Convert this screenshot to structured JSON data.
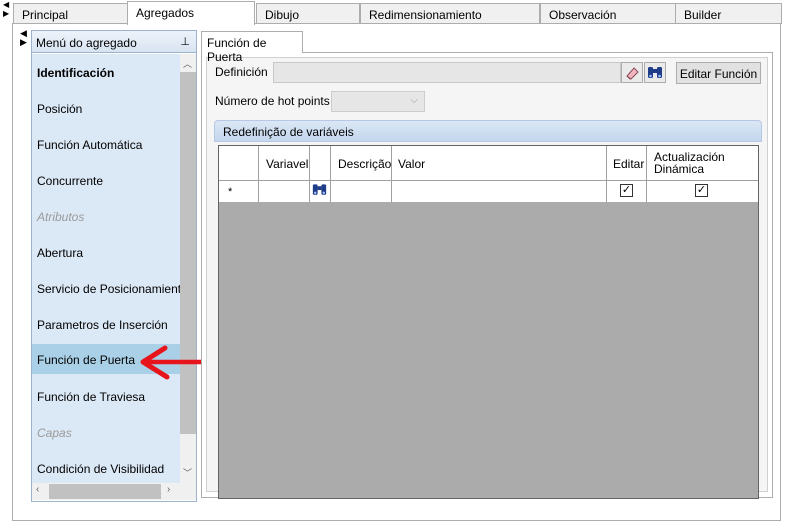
{
  "tabs": [
    {
      "label": "Principal",
      "active": false
    },
    {
      "label": "Agregados",
      "active": true
    },
    {
      "label": "Dibujo",
      "active": false
    },
    {
      "label": "Redimensionamiento",
      "active": false
    },
    {
      "label": "Observación",
      "active": false
    },
    {
      "label": "Builder",
      "active": false
    }
  ],
  "side_menu": {
    "title": "Menú do agregado",
    "items": [
      {
        "label": "Identificación",
        "style": "bold"
      },
      {
        "label": "Posición",
        "style": "normal"
      },
      {
        "label": "Función Automática",
        "style": "normal"
      },
      {
        "label": "Concurrente",
        "style": "normal"
      },
      {
        "label": "Atributos",
        "style": "category"
      },
      {
        "label": "Abertura",
        "style": "normal"
      },
      {
        "label": "Servicio de Posicionamiento",
        "style": "normal"
      },
      {
        "label": "Parametros de Inserción",
        "style": "normal"
      },
      {
        "label": "Función de Puerta",
        "style": "selected"
      },
      {
        "label": "Función de Traviesa",
        "style": "normal"
      },
      {
        "label": "Capas",
        "style": "category"
      },
      {
        "label": "Condición de Visibilidad",
        "style": "normal"
      }
    ]
  },
  "inner_tab": {
    "label": "Función de Puerta"
  },
  "form": {
    "definicion_label": "Definición",
    "definicion_value": "",
    "edit_button": "Editar Función",
    "hot_points_label": "Número de hot points",
    "hot_points_value": ""
  },
  "grid": {
    "title": "Redefinição de variáveis",
    "columns": [
      "",
      "Variavel",
      "",
      "Descrição",
      "Valor",
      "Editar",
      "Actualización Dinámica"
    ],
    "new_row_marker": "*",
    "new_row": {
      "editar_checked": true,
      "dinamica_checked": true
    }
  },
  "colors": {
    "selected_item": "#a9d0e6",
    "menu_bg": "#dbe8f6",
    "arrow": "#e8141c",
    "grid_empty": "#ababab"
  }
}
